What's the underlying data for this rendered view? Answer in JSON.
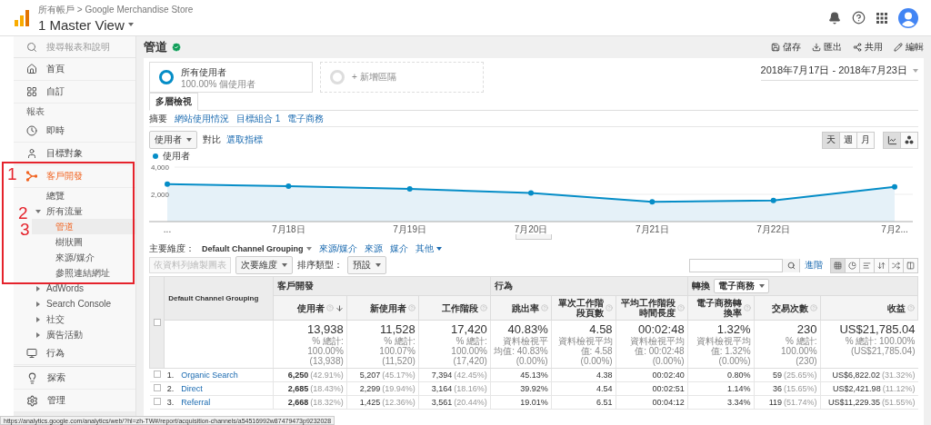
{
  "top_bar": {
    "breadcrumb": "所有帳戶 > Google Merchandise Store",
    "view": "1 Master View"
  },
  "sidebar": {
    "search": {
      "placeholder": "搜尋報表和說明"
    },
    "items": [
      {
        "kind": "nav",
        "label": "首頁",
        "selected": false
      },
      {
        "kind": "nav",
        "label": "自訂",
        "selected": false
      },
      {
        "kind": "heading",
        "label": "報表"
      },
      {
        "kind": "nav",
        "label": "即時",
        "selected": false
      },
      {
        "kind": "nav",
        "label": "目標對象",
        "selected": false
      },
      {
        "kind": "nav",
        "label": "客戶開發",
        "selected": true,
        "children": [
          {
            "kind": "link",
            "label": "總覽",
            "selected": false
          },
          {
            "kind": "group",
            "label": "所有流量",
            "expanded": true,
            "children": [
              {
                "kind": "link",
                "label": "管道",
                "selected": true
              },
              {
                "kind": "link",
                "label": "樹狀圖",
                "selected": false
              },
              {
                "kind": "link",
                "label": "來源/媒介",
                "selected": false
              },
              {
                "kind": "link",
                "label": "參照連結網址",
                "selected": false
              }
            ]
          },
          {
            "kind": "group",
            "label": "AdWords",
            "expanded": false
          },
          {
            "kind": "group",
            "label": "Search Console",
            "expanded": false
          },
          {
            "kind": "group",
            "label": "社交",
            "expanded": false
          },
          {
            "kind": "group",
            "label": "廣告活動",
            "expanded": false
          }
        ]
      },
      {
        "kind": "nav",
        "label": "行為",
        "selected": false
      }
    ],
    "footer": [
      {
        "label": "探索"
      },
      {
        "label": "管理"
      }
    ]
  },
  "annotations": {
    "marks": [
      "1",
      "2",
      "3"
    ]
  },
  "report": {
    "title": "管道",
    "actions": [
      "儲存",
      "匯出",
      "共用",
      "編輯"
    ]
  },
  "segments": [
    {
      "kind": "segment",
      "name": "所有使用者",
      "detail": "100.00% 個使用者"
    },
    {
      "kind": "add",
      "name": "+ 新增區隔"
    }
  ],
  "date_range": "2018年7月17日 - 2018年7月23日",
  "tabs": [
    {
      "label": "多層檢視",
      "selected": true
    }
  ],
  "subtabs": [
    {
      "label": "摘要",
      "selected": true
    },
    {
      "label": "網站使用情況",
      "selected": false
    },
    {
      "label": "目標組合 1",
      "selected": false
    },
    {
      "label": "電子商務",
      "selected": false
    }
  ],
  "metric_picker": {
    "metric": "使用者",
    "compare": "對比",
    "choose": "選取指標"
  },
  "periods": [
    {
      "label": "天",
      "selected": true
    },
    {
      "label": "週",
      "selected": false
    },
    {
      "label": "月",
      "selected": false
    }
  ],
  "chart_types": [
    {
      "selected": true
    },
    {
      "selected": false
    }
  ],
  "chart_data": {
    "type": "area",
    "categories": [
      "...",
      "7月18日",
      "7月19日",
      "7月20日",
      "7月21日",
      "7月22日",
      "7月2..."
    ],
    "series": [
      {
        "name": "使用者",
        "color": "#058dc7",
        "values": [
          2750,
          2600,
          2400,
          2100,
          1450,
          1550,
          2550
        ]
      }
    ],
    "ylim": [
      0,
      4000
    ],
    "yticks": [
      {
        "value": 2000,
        "label": "2,000"
      },
      {
        "value": 4000,
        "label": "4,000"
      }
    ]
  },
  "dimensions": {
    "label": "主要維度：",
    "options": [
      {
        "label": "Default Channel Grouping",
        "selected": true,
        "menu": true
      },
      {
        "label": "來源/媒介",
        "selected": false,
        "menu": false
      },
      {
        "label": "來源",
        "selected": false,
        "menu": false
      },
      {
        "label": "媒介",
        "selected": false,
        "menu": false
      },
      {
        "label": "其他",
        "selected": false,
        "menu": true
      }
    ]
  },
  "toolbar": {
    "plot_rows": {
      "label": "依資料列繪製圖表",
      "disabled": true
    },
    "secondary": "次要維度",
    "sort_label": "排序類型：",
    "sort": "預設",
    "advanced": "進階",
    "view_modes": [
      {
        "selected": true
      },
      {
        "selected": false
      },
      {
        "selected": false
      },
      {
        "selected": false
      },
      {
        "selected": false
      },
      {
        "selected": false
      }
    ]
  },
  "table": {
    "dimension_header": "Default Channel Grouping",
    "checked": false,
    "groups": [
      {
        "label": "客戶開發",
        "columns": [
          {
            "label": "使用者",
            "sorted": true
          },
          {
            "label": "新使用者",
            "sorted": false
          },
          {
            "label": "工作階段",
            "sorted": false
          }
        ]
      },
      {
        "label": "行為",
        "columns": [
          {
            "label": "跳出率",
            "sorted": false
          },
          {
            "label": "單次工作階段頁數",
            "sorted": false
          },
          {
            "label": "平均工作階段時間長度",
            "sorted": false
          }
        ]
      },
      {
        "label": "轉換",
        "selector": "電子商務",
        "columns": [
          {
            "label": "電子商務轉換率",
            "sorted": false
          },
          {
            "label": "交易次數",
            "sorted": false
          },
          {
            "label": "收益",
            "sorted": false
          }
        ]
      }
    ],
    "totals": [
      {
        "value": "13,938",
        "note": "% 總計: 100.00%",
        "base": "(13,938)"
      },
      {
        "value": "11,528",
        "note": "% 總計: 100.07%",
        "base": "(11,520)"
      },
      {
        "value": "17,420",
        "note": "% 總計: 100.00%",
        "base": "(17,420)"
      },
      {
        "value": "40.83%",
        "note": "資料檢視平均值: 40.83%",
        "base": "(0.00%)"
      },
      {
        "value": "4.58",
        "note": "資料檢視平均值: 4.58",
        "base": "(0.00%)"
      },
      {
        "value": "00:02:48",
        "note": "資料檢視平均值: 00:02:48",
        "base": "(0.00%)"
      },
      {
        "value": "1.32%",
        "note": "資料檢視平均值: 1.32%",
        "base": "(0.00%)"
      },
      {
        "value": "230",
        "note": "% 總計: 100.00%",
        "base": "(230)"
      },
      {
        "value": "US$21,785.04",
        "note": "% 總計: 100.00%",
        "base": "(US$21,785.04)"
      }
    ],
    "rows": [
      {
        "index": "1.",
        "label": "Organic Search",
        "checked": false,
        "cells": [
          {
            "value": "6,250",
            "share": "(42.91%)"
          },
          {
            "value": "5,207",
            "share": "(45.17%)"
          },
          {
            "value": "7,394",
            "share": "(42.45%)"
          },
          {
            "value": "45.13%"
          },
          {
            "value": "4.38"
          },
          {
            "value": "00:02:40"
          },
          {
            "value": "0.80%"
          },
          {
            "value": "59",
            "share": "(25.65%)"
          },
          {
            "value": "US$6,822.02",
            "share": "(31.32%)"
          }
        ]
      },
      {
        "index": "2.",
        "label": "Direct",
        "checked": false,
        "cells": [
          {
            "value": "2,685",
            "share": "(18.43%)"
          },
          {
            "value": "2,299",
            "share": "(19.94%)"
          },
          {
            "value": "3,164",
            "share": "(18.16%)"
          },
          {
            "value": "39.92%"
          },
          {
            "value": "4.54"
          },
          {
            "value": "00:02:51"
          },
          {
            "value": "1.14%"
          },
          {
            "value": "36",
            "share": "(15.65%)"
          },
          {
            "value": "US$2,421.98",
            "share": "(11.12%)"
          }
        ]
      },
      {
        "index": "3.",
        "label": "Referral",
        "checked": false,
        "cells": [
          {
            "value": "2,668",
            "share": "(18.32%)"
          },
          {
            "value": "1,425",
            "share": "(12.36%)"
          },
          {
            "value": "3,561",
            "share": "(20.44%)"
          },
          {
            "value": "19.01%"
          },
          {
            "value": "6.51"
          },
          {
            "value": "00:04:12"
          },
          {
            "value": "3.34%"
          },
          {
            "value": "119",
            "share": "(51.74%)"
          },
          {
            "value": "US$11,229.35",
            "share": "(51.55%)"
          }
        ]
      }
    ]
  },
  "status_bar": {
    "url": "https://analytics.google.com/analytics/web/?hl=zh-TW#/report/acquisition-channels/a54516992w87479473p9232028"
  }
}
